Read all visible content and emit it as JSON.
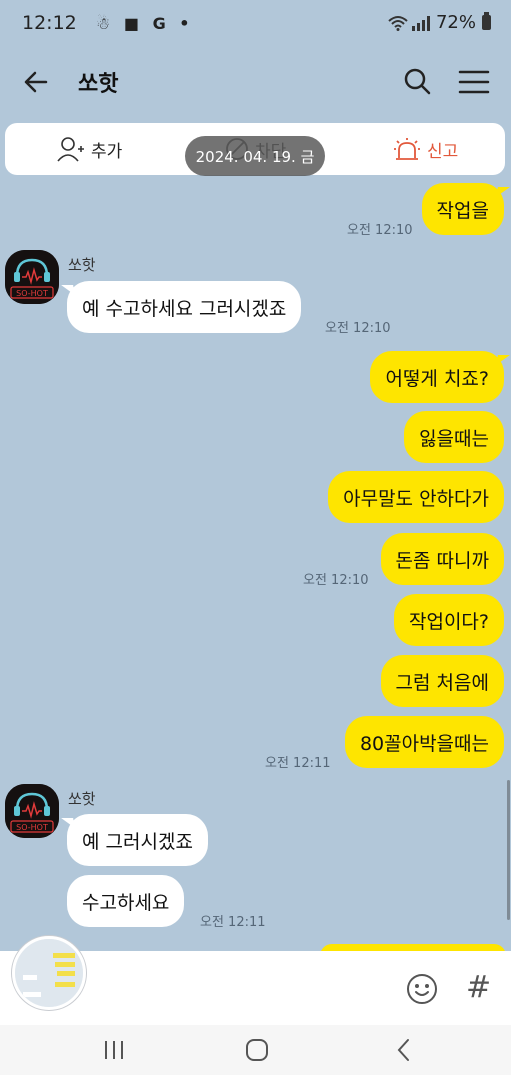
{
  "status_bar": {
    "time": "12:12",
    "indicators": "☃ ■ G •",
    "battery": "72%"
  },
  "header": {
    "title": "쏘핫",
    "back_icon": "arrow-left-icon",
    "search_icon": "search-icon",
    "menu_icon": "hamburger-menu-icon"
  },
  "actions": {
    "add_label": "추가",
    "block_label": "차단",
    "report_label": "신고"
  },
  "date_overlay": "2024. 04. 19. 금",
  "sender_name": "쏘핫",
  "messages": [
    {
      "from": "me",
      "text": "작업을",
      "time": "오전 12:10"
    },
    {
      "from": "them",
      "text": "예 수고하세요 그러시겠죠",
      "time": "오전 12:10"
    },
    {
      "from": "me",
      "text": "어떻게 치죠?",
      "time": ""
    },
    {
      "from": "me",
      "text": "잃을때는",
      "time": ""
    },
    {
      "from": "me",
      "text": "아무말도 안하다가",
      "time": ""
    },
    {
      "from": "me",
      "text": "돈좀 따니까",
      "time": "오전 12:10"
    },
    {
      "from": "me",
      "text": "작업이다?",
      "time": ""
    },
    {
      "from": "me",
      "text": "그럼 처음에",
      "time": ""
    },
    {
      "from": "me",
      "text": "80꼴아박을때는",
      "time": "오전 12:11"
    },
    {
      "from": "them",
      "text": "예 그러시겠죠",
      "time": ""
    },
    {
      "from": "them",
      "text": "수고하세요",
      "time": "오전 12:11"
    }
  ],
  "input_bar": {
    "emoji_icon": "smiley-icon",
    "hash_label": "#"
  },
  "nav_bar": {
    "recent_icon": "recent-apps-icon",
    "home_icon": "home-icon",
    "back_icon": "back-chevron-icon"
  },
  "colors": {
    "background": "#b2c7d9",
    "my_bubble": "#fee500",
    "their_bubble": "#ffffff",
    "report": "#e2583b"
  }
}
